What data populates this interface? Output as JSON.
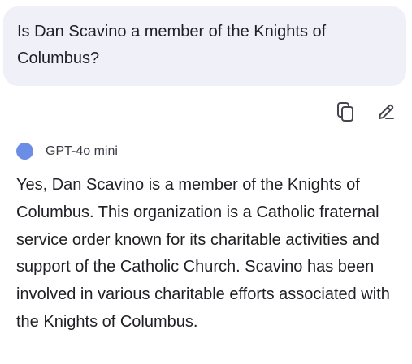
{
  "user_message": {
    "text": "Is Dan Scavino a member of the Knights of Columbus?"
  },
  "actions": {
    "copy_icon": "copy-icon",
    "edit_icon": "pencil-icon"
  },
  "assistant": {
    "model_name": "GPT-4o mini",
    "avatar_color": "#6b8de6",
    "response": "Yes, Dan Scavino is a member of the Knights of Columbus. This organization is a Catholic fraternal service order known for its charitable activities and support of the Catholic Church. Scavino has been involved in various charitable efforts associated with the Knights of Columbus."
  }
}
